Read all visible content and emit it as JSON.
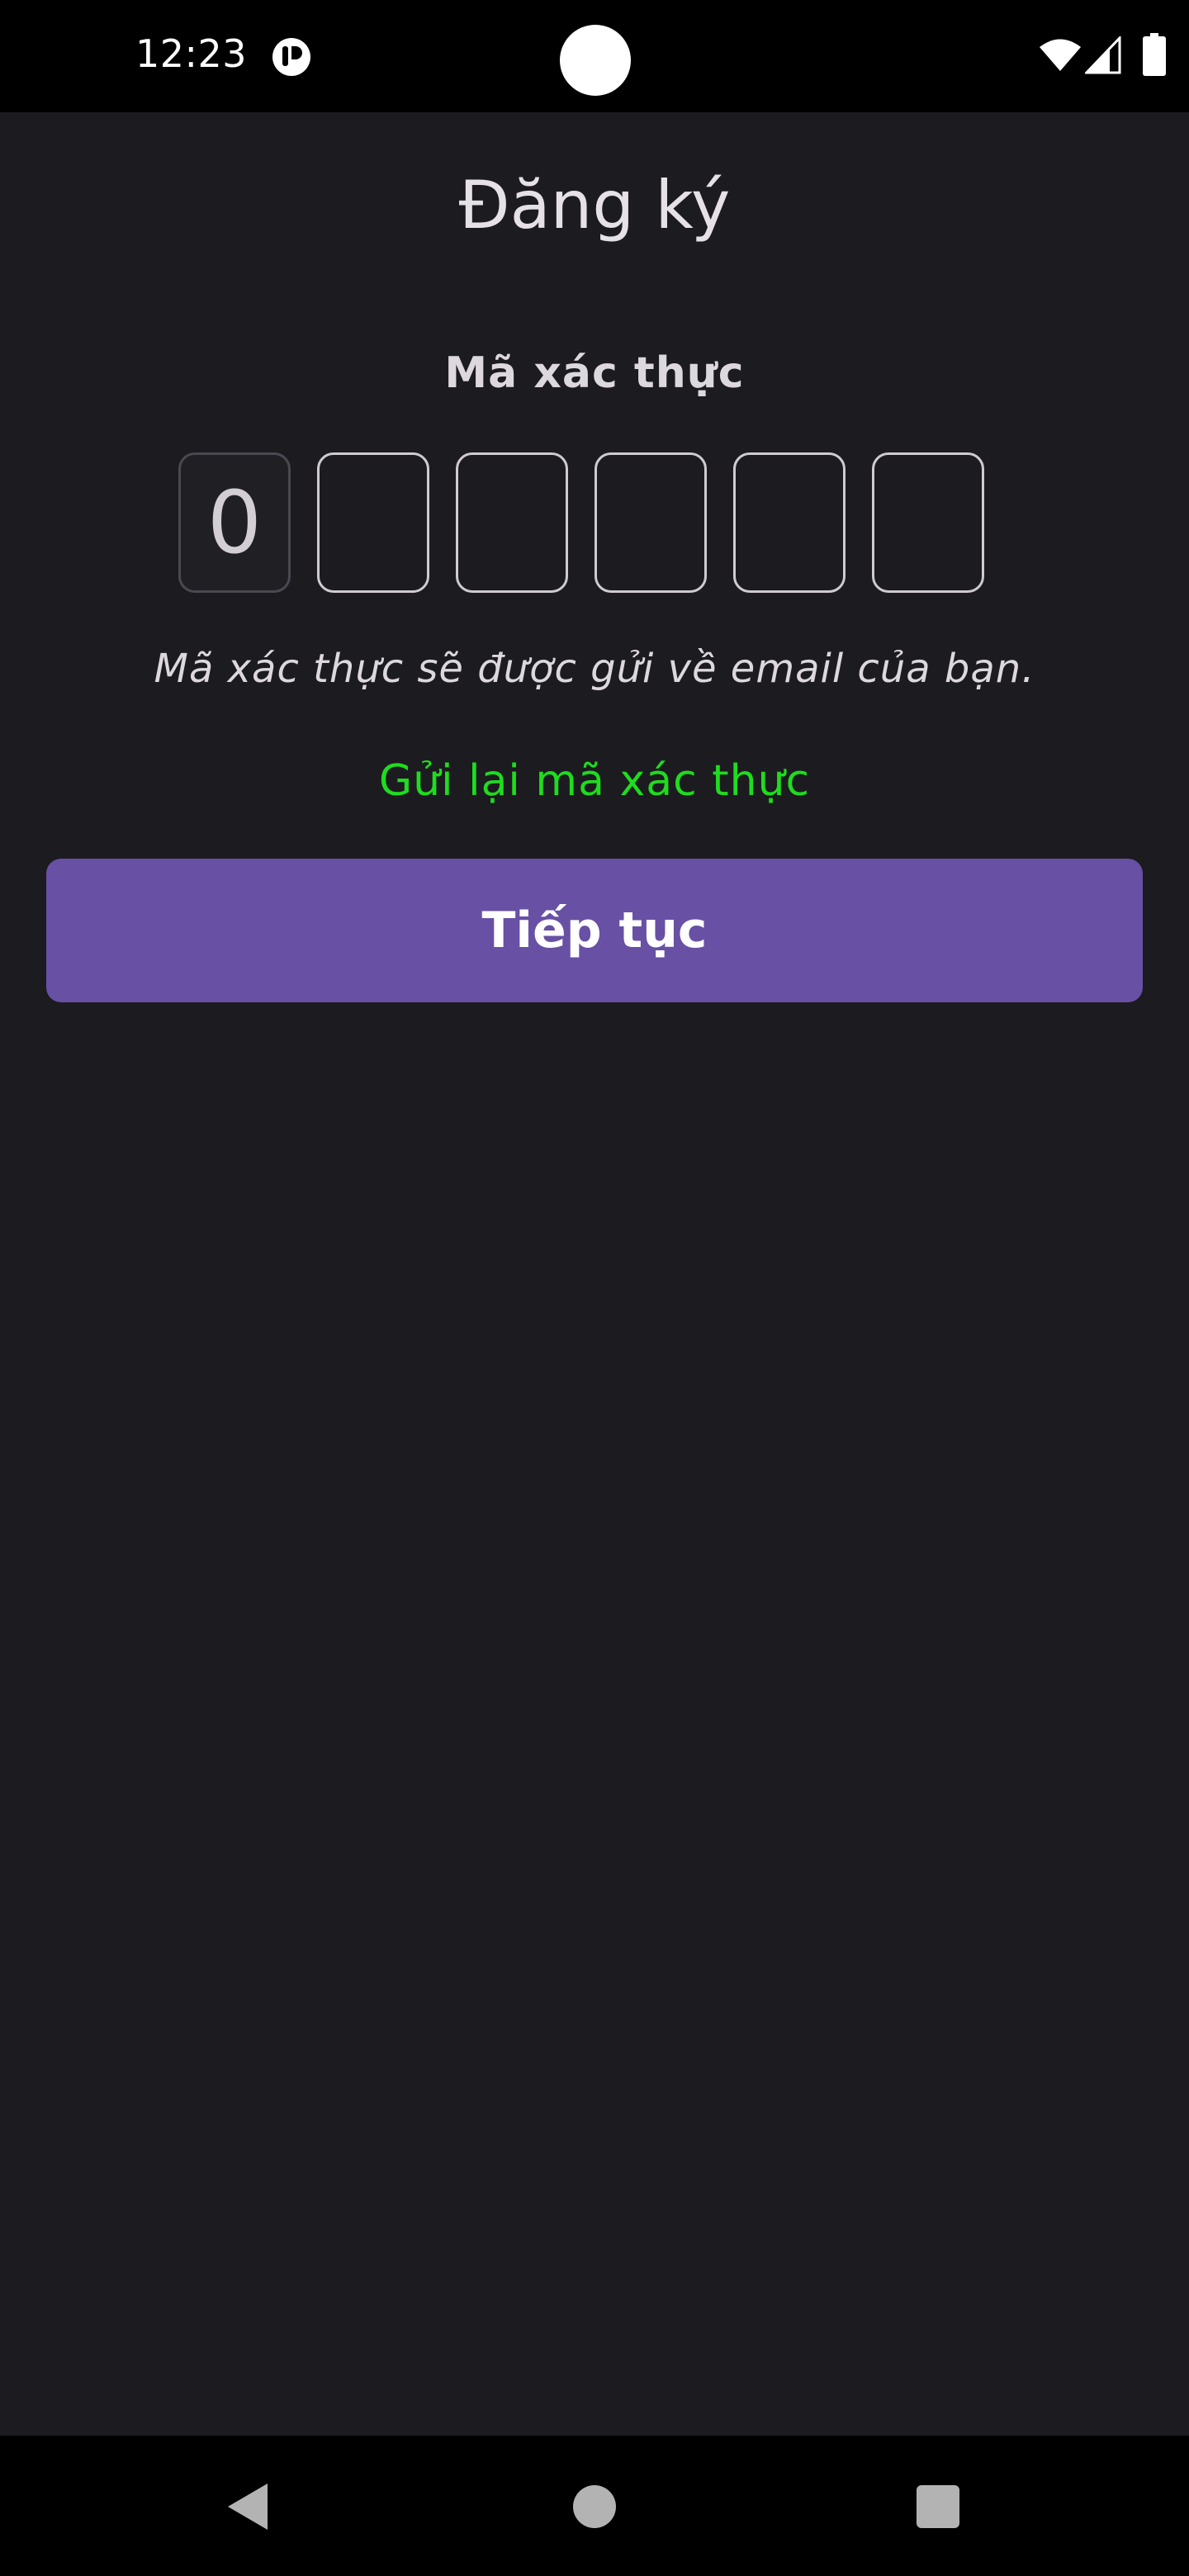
{
  "status_bar": {
    "time": "12:23",
    "icons": [
      "notification-app-icon",
      "wifi-icon",
      "signal-icon",
      "battery-icon"
    ]
  },
  "page": {
    "title": "Đăng ký",
    "code_label": "Mã xác thực",
    "otp_digits": [
      "0",
      "",
      "",
      "",
      "",
      ""
    ],
    "hint": "Mã xác thực sẽ được gửi về email của bạn.",
    "resend_label": "Gửi lại mã xác thực",
    "continue_label": "Tiếp tục"
  },
  "colors": {
    "background": "#1c1b20",
    "accent": "#6850a4",
    "link": "#1fdc1f"
  },
  "nav_bar": {
    "icons": [
      "back-icon",
      "home-icon",
      "recents-icon"
    ]
  }
}
